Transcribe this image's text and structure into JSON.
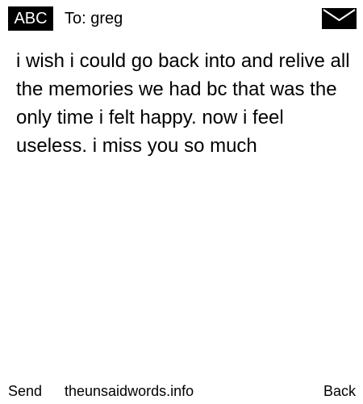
{
  "header": {
    "mode_label": "ABC",
    "recipient": "To: greg",
    "envelope_icon": "envelope-icon"
  },
  "message": {
    "body": "i wish i could go back into and relive all the memories we had bc that was the only time i felt happy. now i feel useless. i miss you so much"
  },
  "footer": {
    "send_label": "Send",
    "site_label": "theunsaidwords.info",
    "back_label": "Back"
  },
  "colors": {
    "background": "#ffffff",
    "text": "#000000",
    "badge_background": "#000000",
    "badge_text": "#ffffff"
  }
}
